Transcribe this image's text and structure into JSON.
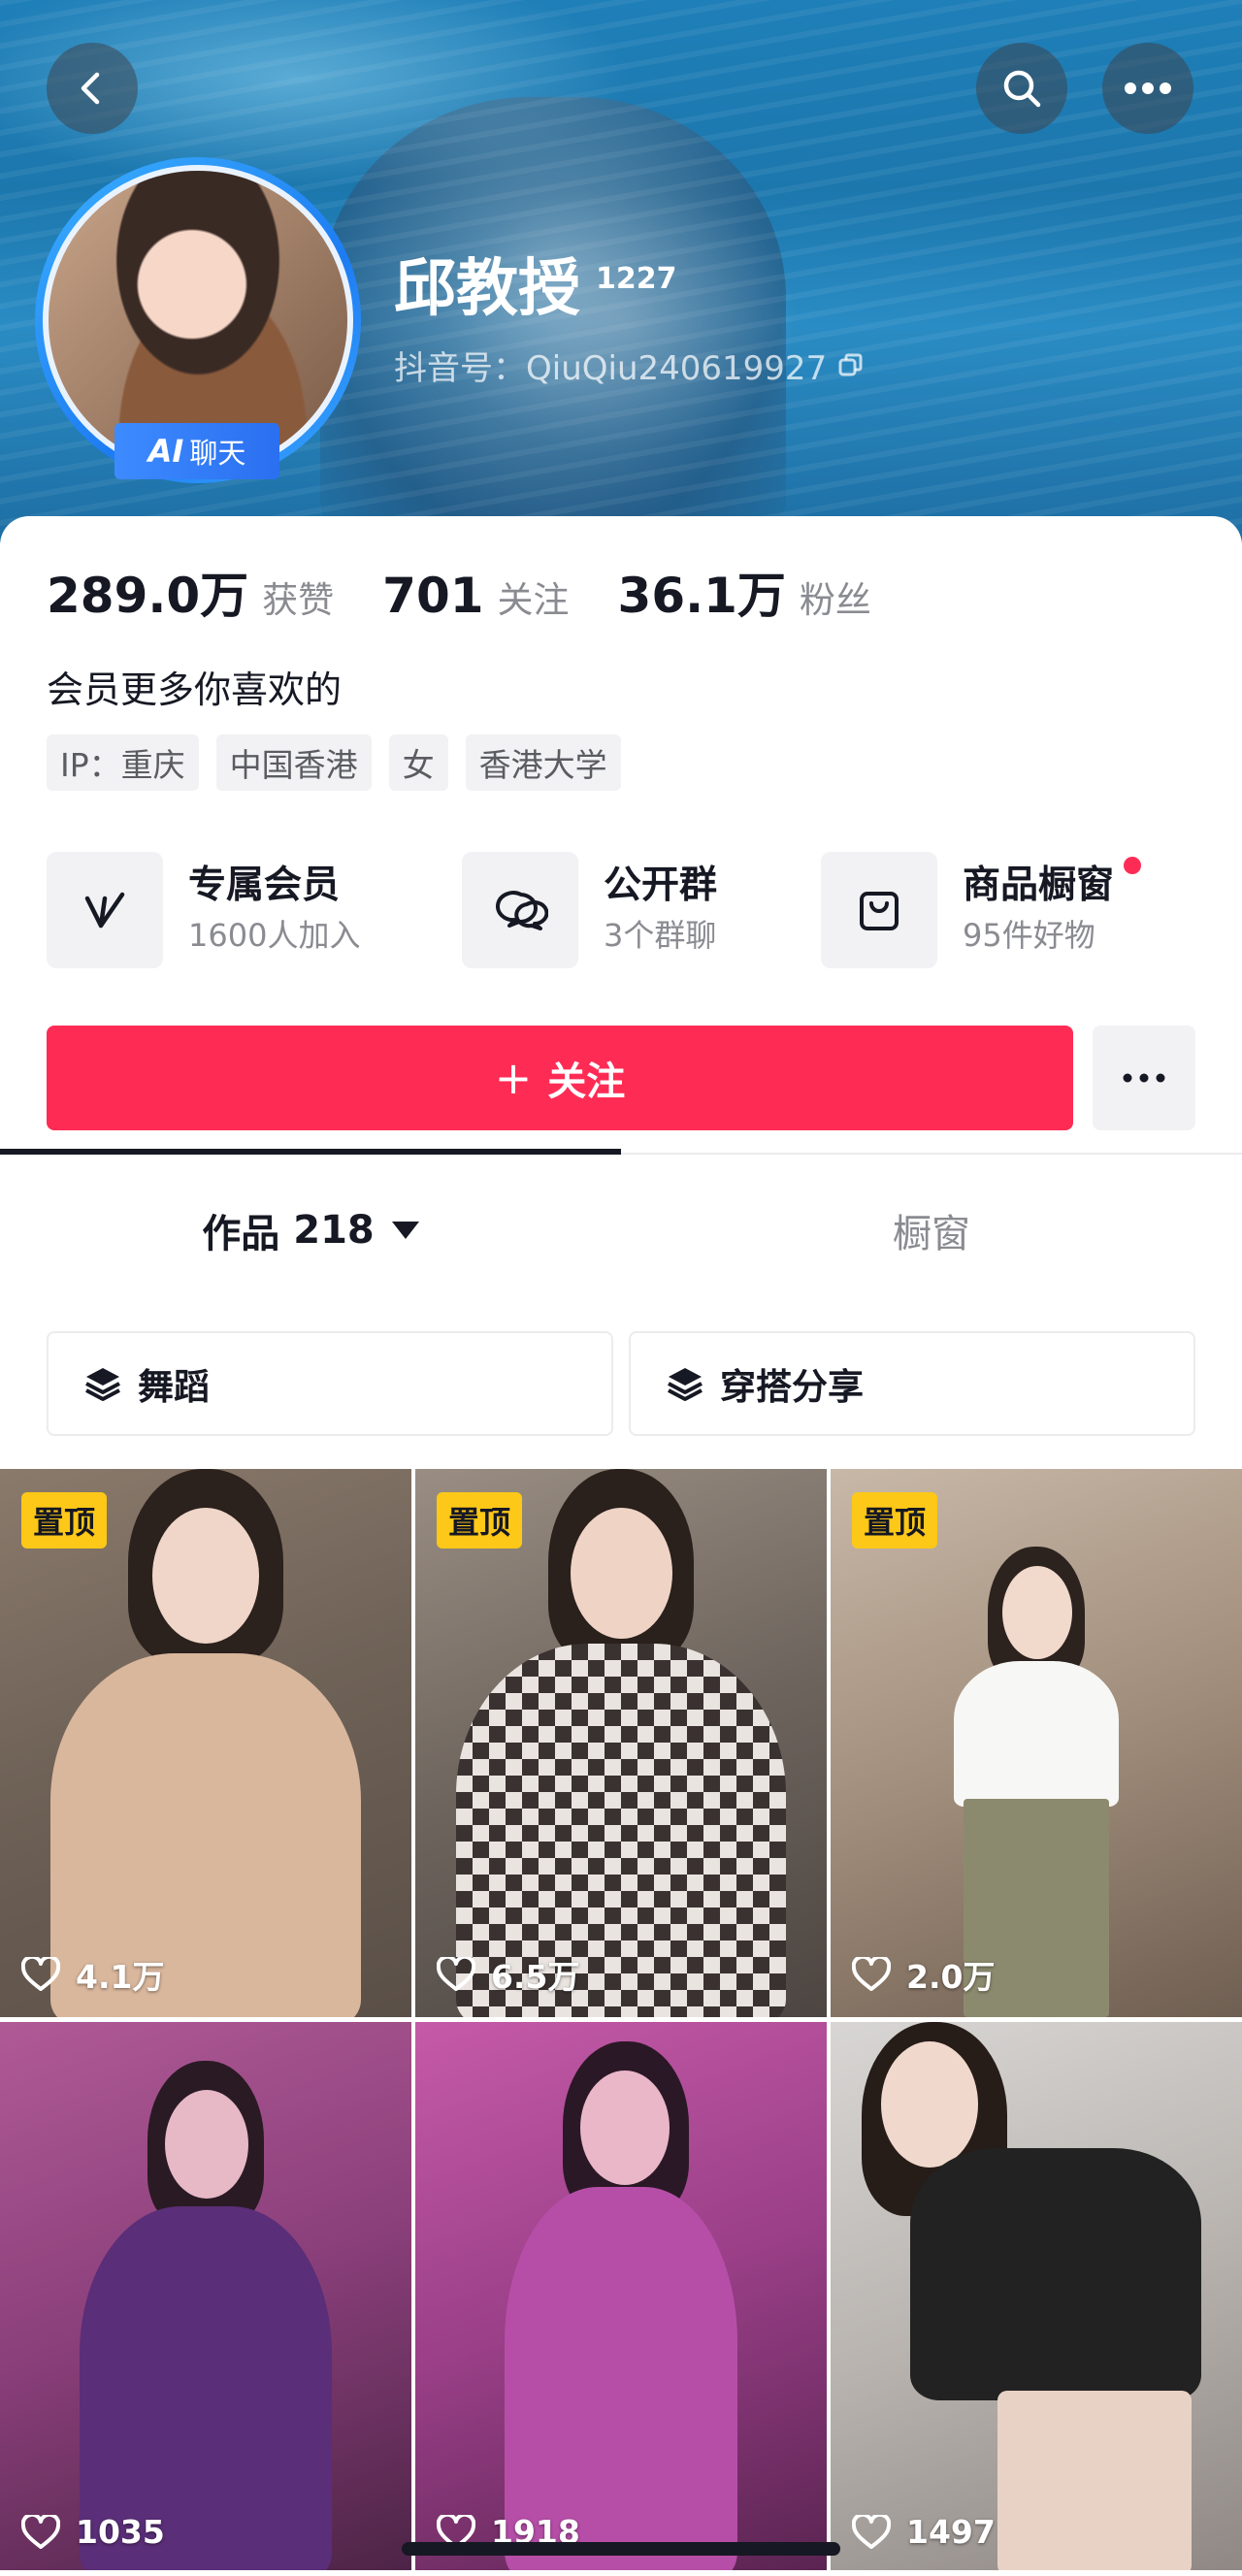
{
  "header": {
    "name": "邱教授",
    "name_sup": "1227",
    "douyin_id": "抖音号：QiuQiu240619927",
    "ai_badge": {
      "ai": "AI",
      "chat": "聊天"
    }
  },
  "stats": [
    {
      "value": "289.0万",
      "label": "获赞"
    },
    {
      "value": "701",
      "label": "关注"
    },
    {
      "value": "36.1万",
      "label": "粉丝"
    }
  ],
  "bio": "会员更多你喜欢的",
  "tags": [
    "IP：重庆",
    "中国香港",
    "女",
    "香港大学"
  ],
  "services": [
    {
      "title": "专属会员",
      "sub": "1600人加入",
      "icon": "v-icon"
    },
    {
      "title": "公开群",
      "sub": "3个群聊",
      "icon": "chat-bubbles-icon"
    },
    {
      "title": "商品橱窗",
      "sub": "95件好物",
      "icon": "shopping-bag-icon"
    }
  ],
  "follow": {
    "plus": "+",
    "label": "关注"
  },
  "tabs": {
    "works_label": "作品",
    "works_count": "218",
    "showcase_label": "橱窗"
  },
  "collections": [
    "舞蹈",
    "穿搭分享"
  ],
  "videos": [
    {
      "pinned": "置顶",
      "likes": "4.1万"
    },
    {
      "pinned": "置顶",
      "likes": "6.5万"
    },
    {
      "pinned": "置顶",
      "likes": "2.0万"
    },
    {
      "pinned": "",
      "likes": "1035"
    },
    {
      "pinned": "",
      "likes": "1918"
    },
    {
      "pinned": "",
      "likes": "1497"
    }
  ],
  "colors": {
    "accent": "#fe2c55",
    "pin": "#fdc817",
    "ai_badge": "#2a6ff0"
  }
}
